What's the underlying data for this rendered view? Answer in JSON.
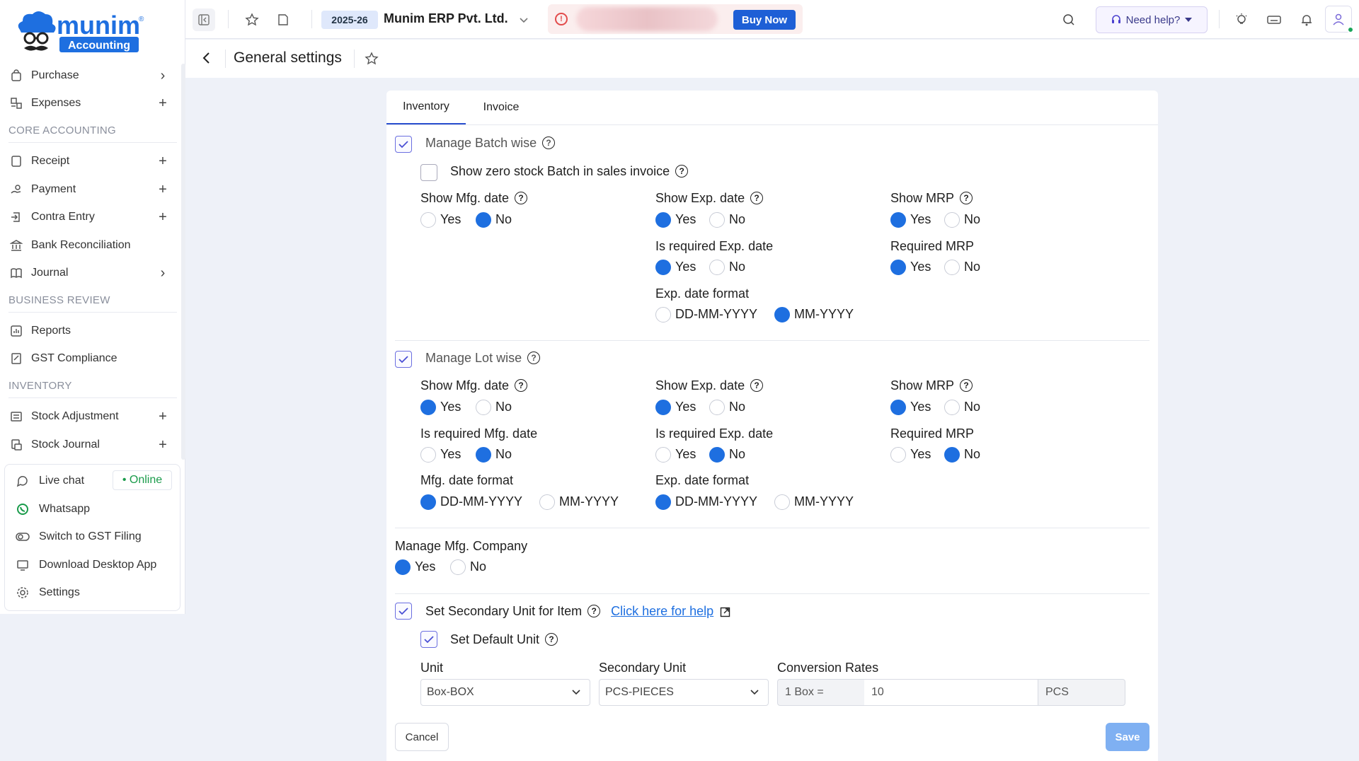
{
  "brand": {
    "name": "munim",
    "sub": "Accounting",
    "reg": "®"
  },
  "sidebar": {
    "items": [
      {
        "label": "Purchase",
        "trail": "›"
      },
      {
        "label": "Expenses",
        "trail": "+"
      }
    ],
    "sections": [
      {
        "title": "CORE ACCOUNTING",
        "items": [
          {
            "label": "Receipt",
            "trail": "+"
          },
          {
            "label": "Payment",
            "trail": "+"
          },
          {
            "label": "Contra Entry",
            "trail": "+"
          },
          {
            "label": "Bank Reconciliation",
            "trail": ""
          },
          {
            "label": "Journal",
            "trail": "›"
          }
        ]
      },
      {
        "title": "BUSINESS REVIEW",
        "items": [
          {
            "label": "Reports",
            "trail": ""
          },
          {
            "label": "GST Compliance",
            "trail": ""
          }
        ]
      },
      {
        "title": "INVENTORY",
        "items": [
          {
            "label": "Stock Adjustment",
            "trail": "+"
          },
          {
            "label": "Stock Journal",
            "trail": "+"
          }
        ]
      }
    ],
    "bottom": [
      {
        "label": "Live chat"
      },
      {
        "label": "Whatsapp"
      },
      {
        "label": "Switch to GST Filing"
      },
      {
        "label": "Download Desktop App"
      },
      {
        "label": "Settings"
      }
    ],
    "online_label": "• Online"
  },
  "topbar": {
    "year": "2025-26",
    "company": "Munim ERP Pvt. Ltd.",
    "buy_now": "Buy Now",
    "need_help": "Need help?"
  },
  "page": {
    "title": "General settings"
  },
  "tabs": [
    {
      "label": "Inventory"
    },
    {
      "label": "Invoice"
    }
  ],
  "batch": {
    "title": "Manage Batch wise",
    "zero_stock": "Show zero stock Batch in sales invoice",
    "show_mfg": "Show Mfg. date",
    "show_exp": "Show Exp. date",
    "show_mrp": "Show MRP",
    "req_exp": "Is required Exp. date",
    "req_mrp": "Required MRP",
    "exp_format": "Exp. date format"
  },
  "lot": {
    "title": "Manage Lot wise",
    "show_mfg": "Show Mfg. date",
    "show_exp": "Show Exp. date",
    "show_mrp": "Show MRP",
    "req_mfg": "Is required Mfg. date",
    "req_exp": "Is required Exp. date",
    "req_mrp": "Required MRP",
    "mfg_format": "Mfg. date format",
    "exp_format": "Exp. date format"
  },
  "options": {
    "yes": "Yes",
    "no": "No",
    "ddmmyyyy": "DD-MM-YYYY",
    "mmyyyy": "MM-YYYY"
  },
  "mfg_company": {
    "title": "Manage Mfg. Company"
  },
  "secondary": {
    "title": "Set Secondary Unit for Item",
    "help_link": "Click here for help",
    "default_unit": "Set Default Unit",
    "unit_label": "Unit",
    "unit_value": "Box-BOX",
    "sec_label": "Secondary Unit",
    "sec_value": "PCS-PIECES",
    "conv_label": "Conversion Rates",
    "conv_prefix": "1 Box =",
    "conv_value": "10",
    "conv_suffix": "PCS"
  },
  "footer": {
    "cancel": "Cancel",
    "save": "Save"
  },
  "colors": {
    "accent": "#1e6fe0",
    "brand": "#1e5fd6",
    "online": "#1a9b4b"
  }
}
